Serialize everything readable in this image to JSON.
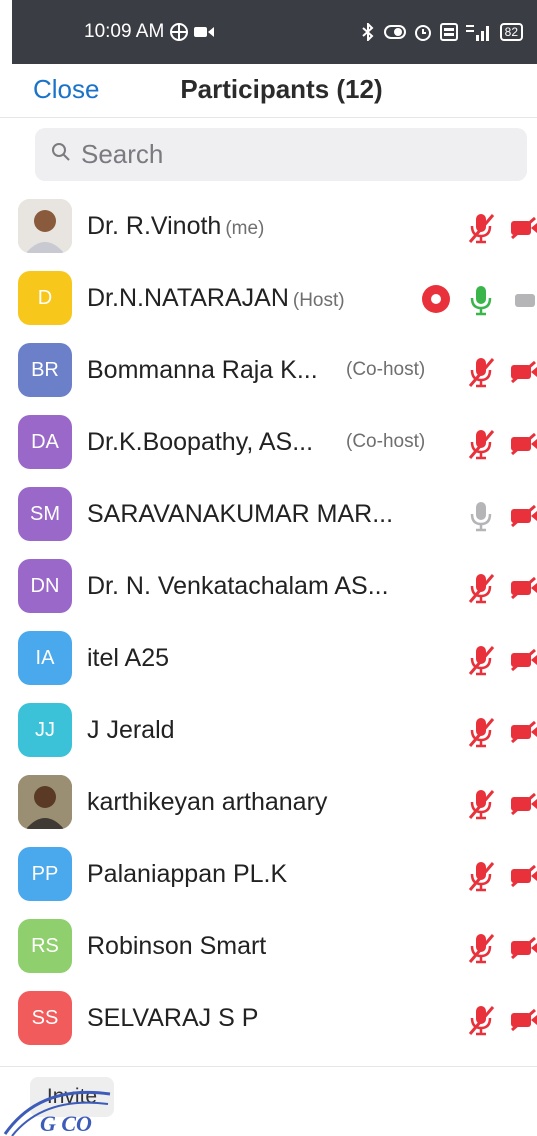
{
  "status_bar": {
    "time": "10:09 AM",
    "battery": "82"
  },
  "header": {
    "close_label": "Close",
    "title": "Participants (12)"
  },
  "search": {
    "placeholder": "Search"
  },
  "participants": [
    {
      "initials": "",
      "name": "Dr. R.Vinoth",
      "tag": "(me)",
      "tag_style": "inline",
      "avatar": "photo",
      "avatar_color": "#d9d4ce",
      "mic": "muted",
      "cam": "off",
      "recording": false
    },
    {
      "initials": "D",
      "name": "Dr.N.NATARAJAN",
      "tag": "(Host)",
      "tag_style": "inline",
      "avatar": "initials",
      "avatar_color": "#f7c71b",
      "mic": "on",
      "cam": "on",
      "recording": true
    },
    {
      "initials": "BR",
      "name": "Bommanna Raja K...",
      "tag": "(Co-host)",
      "tag_style": "right",
      "avatar": "initials",
      "avatar_color": "#6c7fc9",
      "mic": "muted",
      "cam": "off",
      "recording": false
    },
    {
      "initials": "DA",
      "name": "Dr.K.Boopathy, AS...",
      "tag": "(Co-host)",
      "tag_style": "right",
      "avatar": "initials",
      "avatar_color": "#9a68c9",
      "mic": "muted",
      "cam": "off",
      "recording": false
    },
    {
      "initials": "SM",
      "name": "SARAVANAKUMAR MAR...",
      "tag": "",
      "tag_style": "none",
      "avatar": "initials",
      "avatar_color": "#9a68c9",
      "mic": "idle",
      "cam": "off",
      "recording": false
    },
    {
      "initials": "DN",
      "name": "Dr. N. Venkatachalam AS...",
      "tag": "",
      "tag_style": "none",
      "avatar": "initials",
      "avatar_color": "#9a68c9",
      "mic": "muted",
      "cam": "off",
      "recording": false
    },
    {
      "initials": "IA",
      "name": "itel A25",
      "tag": "",
      "tag_style": "none",
      "avatar": "initials",
      "avatar_color": "#4aa8ec",
      "mic": "muted",
      "cam": "off",
      "recording": false
    },
    {
      "initials": "JJ",
      "name": "J Jerald",
      "tag": "",
      "tag_style": "none",
      "avatar": "initials",
      "avatar_color": "#3cc2d8",
      "mic": "muted",
      "cam": "off",
      "recording": false
    },
    {
      "initials": "",
      "name": "karthikeyan arthanary",
      "tag": "",
      "tag_style": "none",
      "avatar": "photo",
      "avatar_color": "#8c6b4f",
      "mic": "muted",
      "cam": "off",
      "recording": false
    },
    {
      "initials": "PP",
      "name": "Palaniappan PL.K",
      "tag": "",
      "tag_style": "none",
      "avatar": "initials",
      "avatar_color": "#4aa8ec",
      "mic": "muted",
      "cam": "off",
      "recording": false
    },
    {
      "initials": "RS",
      "name": "Robinson Smart",
      "tag": "",
      "tag_style": "none",
      "avatar": "initials",
      "avatar_color": "#8fcf6e",
      "mic": "muted",
      "cam": "off",
      "recording": false
    },
    {
      "initials": "SS",
      "name": "SELVARAJ S P",
      "tag": "",
      "tag_style": "none",
      "avatar": "initials",
      "avatar_color": "#f15b5b",
      "mic": "muted",
      "cam": "off",
      "recording": false
    }
  ],
  "footer": {
    "invite_label": "Invite"
  },
  "colors": {
    "accent": "#1a73c9",
    "muted_red": "#e8313b",
    "mic_on_green": "#3ab54a",
    "idle_gray": "#b5b5b8"
  }
}
